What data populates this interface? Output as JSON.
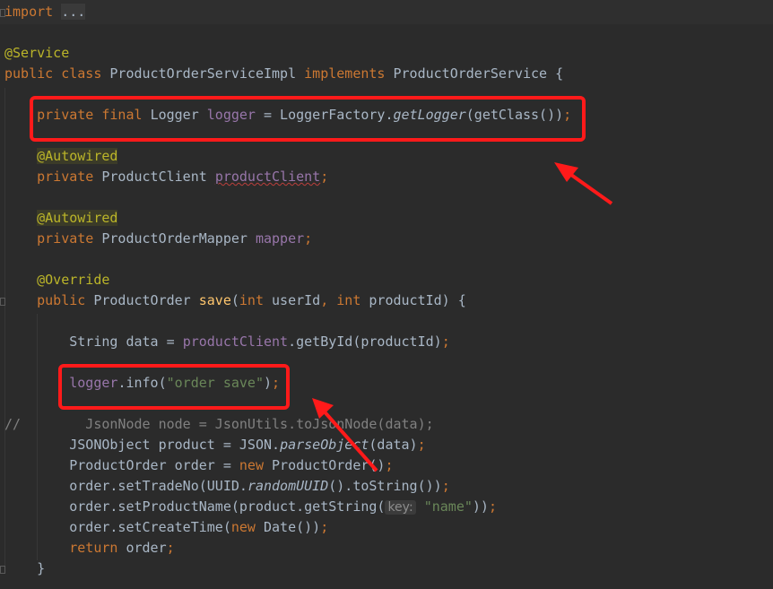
{
  "editor": {
    "lines": [
      [
        [
          "import",
          "kw"
        ],
        [
          " ",
          ""
        ],
        [
          "...",
          "fold"
        ]
      ],
      [],
      [
        [
          "@Service",
          "ann"
        ]
      ],
      [
        [
          "public class ",
          "kw"
        ],
        [
          "ProductOrderServiceImpl ",
          ""
        ],
        [
          "implements ",
          "kw"
        ],
        [
          "ProductOrderService {",
          ""
        ]
      ],
      [],
      [
        [
          "    ",
          ""
        ],
        [
          "private final ",
          "kw"
        ],
        [
          "Logger ",
          ""
        ],
        [
          "logger",
          "field"
        ],
        [
          " = LoggerFactory.",
          ""
        ],
        [
          "getLogger",
          "it"
        ],
        [
          "(getClass())",
          ""
        ],
        [
          ";",
          "kw"
        ]
      ],
      [],
      [
        [
          "    ",
          ""
        ],
        [
          "@Autowired",
          "ann-hl"
        ]
      ],
      [
        [
          "    ",
          ""
        ],
        [
          "private ",
          "kw"
        ],
        [
          "ProductClient ",
          ""
        ],
        [
          "productClient",
          "field under"
        ],
        [
          ";",
          "kw"
        ]
      ],
      [],
      [
        [
          "    ",
          ""
        ],
        [
          "@Autowired",
          "ann-hl"
        ]
      ],
      [
        [
          "    ",
          ""
        ],
        [
          "private ",
          "kw"
        ],
        [
          "ProductOrderMapper ",
          ""
        ],
        [
          "mapper",
          "field"
        ],
        [
          ";",
          "kw"
        ]
      ],
      [],
      [
        [
          "    ",
          ""
        ],
        [
          "@Override",
          "ann"
        ]
      ],
      [
        [
          "    ",
          ""
        ],
        [
          "public ",
          "kw"
        ],
        [
          "ProductOrder ",
          ""
        ],
        [
          "save",
          "fn"
        ],
        [
          "(",
          ""
        ],
        [
          "int ",
          "kw"
        ],
        [
          "userId",
          ""
        ],
        [
          ", ",
          "kw"
        ],
        [
          "int ",
          "kw"
        ],
        [
          "productId) {",
          ""
        ]
      ],
      [],
      [
        [
          "        ",
          ""
        ],
        [
          "String data = ",
          ""
        ],
        [
          "productClient",
          "field"
        ],
        [
          ".getById(productId)",
          ""
        ],
        [
          ";",
          "kw"
        ]
      ],
      [],
      [
        [
          "        ",
          ""
        ],
        [
          "logger",
          "field"
        ],
        [
          ".info(",
          ""
        ],
        [
          "\"order save\"",
          "str"
        ],
        [
          ")",
          ""
        ],
        [
          ";",
          "kw"
        ]
      ],
      [],
      [
        [
          "//        JsonNode node = JsonUtils.toJsonNode(data);",
          "cmt"
        ]
      ],
      [
        [
          "        ",
          ""
        ],
        [
          "JSONObject product = JSON.",
          ""
        ],
        [
          "parseObject",
          "it"
        ],
        [
          "(data)",
          ""
        ],
        [
          ";",
          "kw"
        ]
      ],
      [
        [
          "        ",
          ""
        ],
        [
          "ProductOrder order = ",
          ""
        ],
        [
          "new ",
          "kw"
        ],
        [
          "ProductOrder()",
          ""
        ],
        [
          ";",
          "kw"
        ]
      ],
      [
        [
          "        ",
          ""
        ],
        [
          "order.setTradeNo(UUID.",
          ""
        ],
        [
          "randomUUID",
          "it"
        ],
        [
          "().toString())",
          ""
        ],
        [
          ";",
          "kw"
        ]
      ],
      [
        [
          "        ",
          ""
        ],
        [
          "order.setProductName(product.getString(",
          ""
        ],
        [
          "key:",
          "hint"
        ],
        [
          " ",
          ""
        ],
        [
          "\"name\"",
          "str"
        ],
        [
          "))",
          ""
        ],
        [
          ";",
          "kw"
        ]
      ],
      [
        [
          "        ",
          ""
        ],
        [
          "order.setCreateTime(",
          ""
        ],
        [
          "new ",
          "kw"
        ],
        [
          "Date())",
          ""
        ],
        [
          ";",
          "kw"
        ]
      ],
      [
        [
          "        ",
          ""
        ],
        [
          "return ",
          "kw"
        ],
        [
          "order",
          ""
        ],
        [
          ";",
          "kw"
        ]
      ],
      [
        [
          "    }",
          ""
        ]
      ]
    ]
  },
  "colors": {
    "background": "#2b2b2b",
    "keyword": "#cc7832",
    "annotation": "#bbb529",
    "field": "#9876aa",
    "string": "#6a8759",
    "text": "#a9b7c6",
    "comment": "#808080",
    "highlight_box": "#ff1a1a"
  }
}
